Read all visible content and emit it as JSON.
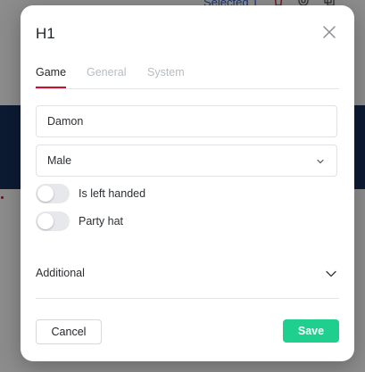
{
  "background": {
    "selected_text": "Selected 1",
    "toolbar_icons": [
      "trash-icon",
      "settings-icon",
      "copy-icon"
    ]
  },
  "modal": {
    "title": "H1",
    "close_icon": "close-icon",
    "tabs": [
      {
        "label": "Game",
        "active": true
      },
      {
        "label": "General",
        "active": false
      },
      {
        "label": "System",
        "active": false
      }
    ],
    "name_field": {
      "value": "Damon"
    },
    "gender_select": {
      "value": "Male",
      "icon": "chevron-down-icon"
    },
    "toggles": [
      {
        "label": "Is left handed",
        "on": false
      },
      {
        "label": "Party hat",
        "on": false
      }
    ],
    "additional": {
      "label": "Additional",
      "icon": "chevron-down-icon"
    },
    "footer": {
      "cancel_label": "Cancel",
      "save_label": "Save"
    }
  },
  "colors": {
    "accent_tab": "#c8102e",
    "save_button": "#1fcf8e",
    "background_band": "#16305c"
  }
}
